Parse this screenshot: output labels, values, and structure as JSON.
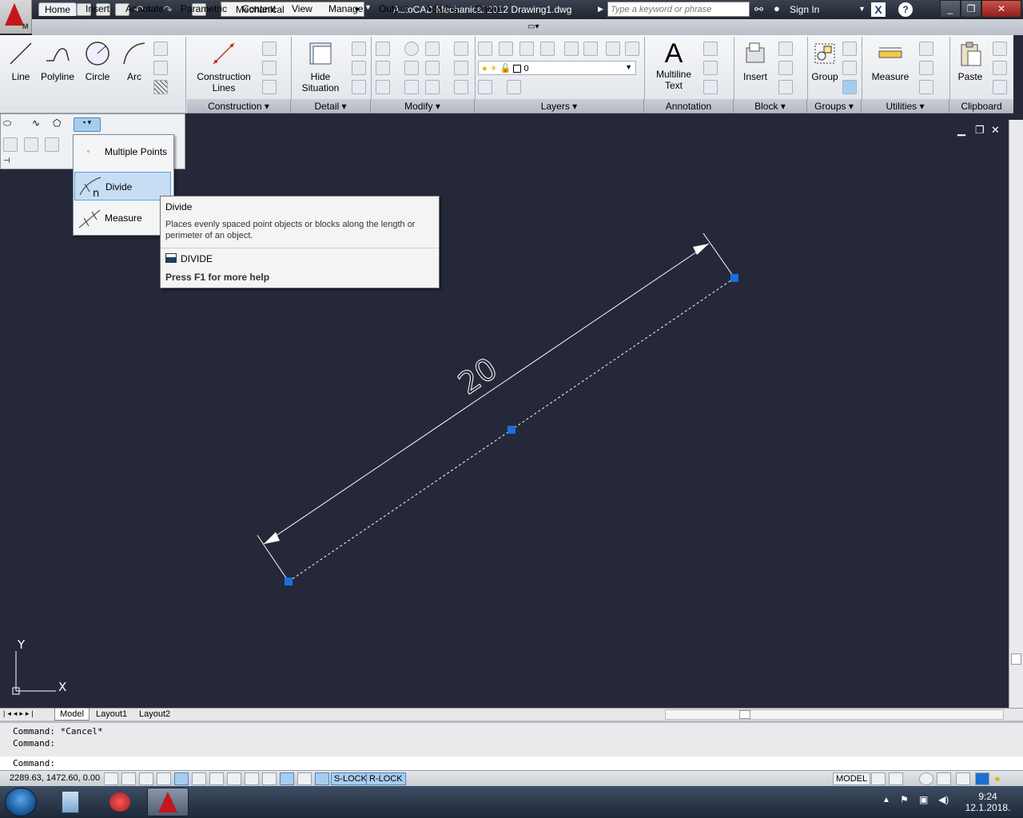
{
  "window": {
    "workspace": "Mechanical",
    "title": "AutoCAD Mechanical 2012    Drawing1.dwg",
    "search_placeholder": "Type a keyword or phrase",
    "sign_in": "Sign In",
    "logo_letter": "M"
  },
  "tabs": [
    "Home",
    "Insert",
    "Annotate",
    "Parametric",
    "Content",
    "View",
    "Manage",
    "Output",
    "Add-Ins",
    "Online"
  ],
  "ribbon": {
    "draw": {
      "line": "Line",
      "polyline": "Polyline",
      "circle": "Circle",
      "arc": "Arc"
    },
    "construction": {
      "label1": "Construction",
      "label2": "Lines",
      "panel": "Construction"
    },
    "detail": {
      "label1": "Hide",
      "label2": "Situation",
      "panel": "Detail"
    },
    "modify_panel": "Modify",
    "layers": {
      "layer_name": "0",
      "panel": "Layers"
    },
    "annotation": {
      "label1": "Multiline",
      "label2": "Text",
      "panel": "Annotation"
    },
    "block": {
      "insert": "Insert",
      "panel": "Block"
    },
    "groups": {
      "group": "Group",
      "panel": "Groups"
    },
    "utilities": {
      "measure": "Measure",
      "panel": "Utilities"
    },
    "clipboard": {
      "paste": "Paste",
      "panel": "Clipboard"
    }
  },
  "flyout": {
    "items": [
      "Multiple Points",
      "Divide",
      "Measure"
    ]
  },
  "tooltip": {
    "title": "Divide",
    "description": "Places evenly spaced point objects or blocks along the length or perimeter of an object.",
    "command": "DIVIDE",
    "help": "Press F1 for more help"
  },
  "drawing": {
    "dimension_text": "20",
    "ucs_x": "X",
    "ucs_y": "Y",
    "line_color": "#ffffff",
    "grip_color": "#1a6fdc",
    "background": "#252839"
  },
  "layouts": [
    "Model",
    "Layout1",
    "Layout2"
  ],
  "command": {
    "history": [
      "Command: *Cancel*",
      "Command:"
    ],
    "prompt": "Command:"
  },
  "status": {
    "coords": "2289.63, 1472.60, 0.00",
    "slock": "S-LOCK",
    "rlock": "R-LOCK",
    "model": "MODEL"
  },
  "taskbar": {
    "time": "9:24",
    "date": "12.1.2018."
  }
}
